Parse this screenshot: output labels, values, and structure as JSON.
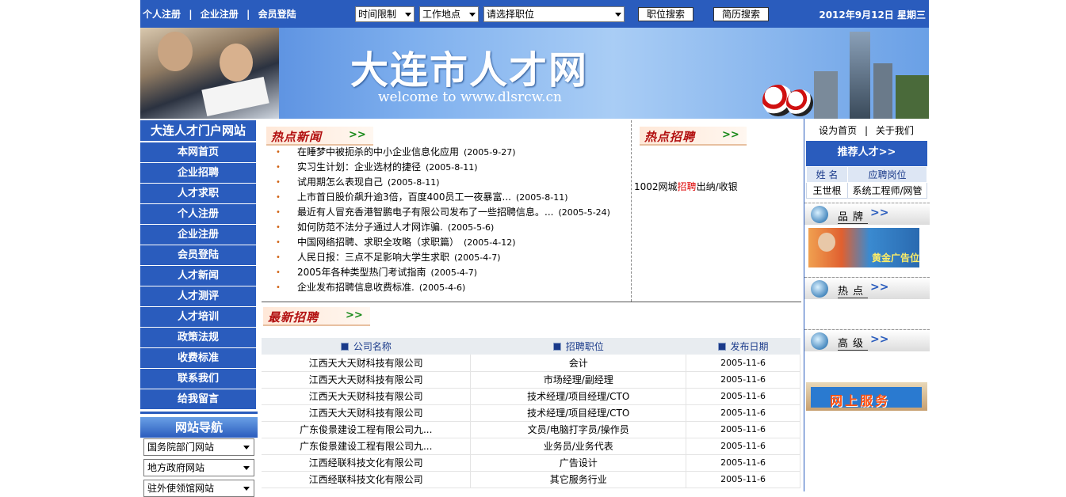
{
  "topbar": {
    "links": [
      "个人注册",
      "企业注册",
      "会员登陆"
    ],
    "select_time": "时间限制",
    "select_place": "工作地点",
    "select_position": "请选择职位",
    "btn_job_search": "职位搜索",
    "btn_resume_search": "简历搜索",
    "date": "2012年9月12日 星期三"
  },
  "banner": {
    "title": "大连市人才网",
    "welcome": "welcome to www.dlsrcw.cn"
  },
  "left": {
    "portal_title": "大连人才门户网站",
    "menu": [
      "本网首页",
      "企业招聘",
      "人才求职",
      "个人注册",
      "企业注册",
      "会员登陆",
      "人才新闻",
      "人才测评",
      "人才培训",
      "政策法规",
      "收费标准",
      "联系我们",
      "给我留言"
    ],
    "nav_title": "网站导航",
    "nav_selects": [
      "国务院部门网站",
      "地方政府网站",
      "驻外使领馆网站"
    ]
  },
  "hot_news": {
    "title": "热点新闻",
    "arrow": ">>",
    "items": [
      {
        "title": "在睡梦中被扼杀的中小企业信息化应用",
        "date": "(2005-9-27)"
      },
      {
        "title": "实习生计划：企业选材的捷径",
        "date": "(2005-8-11)"
      },
      {
        "title": "试用期怎么表现自己",
        "date": "(2005-8-11)"
      },
      {
        "title": "上市首日股价飙升逾3倍，百度400员工一夜暴富...",
        "date": "(2005-8-11)"
      },
      {
        "title": "最近有人冒充香港智鹏电子有限公司发布了一些招聘信息。...",
        "date": "(2005-5-24)"
      },
      {
        "title": "如何防范不法分子通过人才网诈骗.",
        "date": "(2005-5-6)"
      },
      {
        "title": "中国网络招聘、求职全攻略（求职篇）",
        "date": "(2005-4-12)"
      },
      {
        "title": "人民日报：三点不足影响大学生求职",
        "date": "(2005-4-7)"
      },
      {
        "title": "2005年各种类型热门考试指南",
        "date": "(2005-4-7)"
      },
      {
        "title": "企业发布招聘信息收费标准.",
        "date": "(2005-4-6)"
      }
    ]
  },
  "hot_jobs": {
    "title": "热点招聘",
    "arrow": ">>",
    "entry_prefix": "1002网城",
    "entry_red": "招聘",
    "entry_suffix": "出纳/收银"
  },
  "latest_jobs": {
    "title": "最新招聘",
    "arrow": ">>",
    "columns": [
      "公司名称",
      "招聘职位",
      "发布日期"
    ],
    "rows": [
      [
        "江西天大天财科技有限公司",
        "会计",
        "2005-11-6"
      ],
      [
        "江西天大天财科技有限公司",
        "市场经理/副经理",
        "2005-11-6"
      ],
      [
        "江西天大天财科技有限公司",
        "技术经理/项目经理/CTO",
        "2005-11-6"
      ],
      [
        "江西天大天财科技有限公司",
        "技术经理/项目经理/CTO",
        "2005-11-6"
      ],
      [
        "广东俊景建设工程有限公司九...",
        "文员/电脑打字员/操作员",
        "2005-11-6"
      ],
      [
        "广东俊景建设工程有限公司九...",
        "业务员/业务代表",
        "2005-11-6"
      ],
      [
        "江西经联科技文化有限公司",
        "广告设计",
        "2005-11-6"
      ],
      [
        "江西经联科技文化有限公司",
        "其它服务行业",
        "2005-11-6"
      ]
    ]
  },
  "right": {
    "link_home": "设为首页",
    "sep": "|",
    "link_about": "关于我们",
    "recommend_title": "推荐人才>>",
    "recommend_cols": [
      "姓 名",
      "应聘岗位"
    ],
    "recommend_rows": [
      [
        "王世根",
        "系统工程师/网管"
      ]
    ],
    "sec_brand": "品牌",
    "ad_text": "黄金广告位",
    "sec_hot": "热点",
    "sec_senior": "高级",
    "sec_arrow": ">>",
    "online_service": "网上服务"
  },
  "colors": {
    "brand_blue": "#2a5cbd",
    "hot_red": "#b21010",
    "arrow_green": "#1a8a1a"
  }
}
